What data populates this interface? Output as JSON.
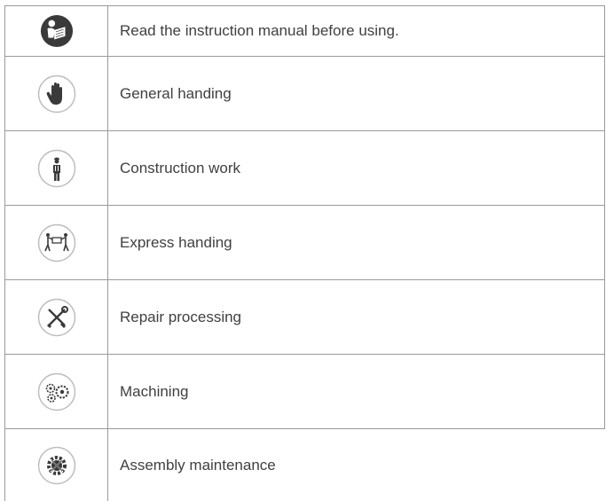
{
  "rows": [
    {
      "icon": "read-manual-icon",
      "label": "Read the instruction manual before using."
    },
    {
      "icon": "hand-icon",
      "label": "General handing"
    },
    {
      "icon": "worker-icon",
      "label": "Construction work"
    },
    {
      "icon": "carrying-box-icon",
      "label": "Express handing"
    },
    {
      "icon": "tools-icon",
      "label": "Repair processing"
    },
    {
      "icon": "gears-icon",
      "label": "Machining"
    },
    {
      "icon": "assembly-gear-icon",
      "label": "Assembly maintenance"
    }
  ],
  "colors": {
    "border": "#9a9a9a",
    "text": "#404040",
    "icon_dark": "#3a3a3a",
    "icon_ring": "#bdbdbd"
  }
}
